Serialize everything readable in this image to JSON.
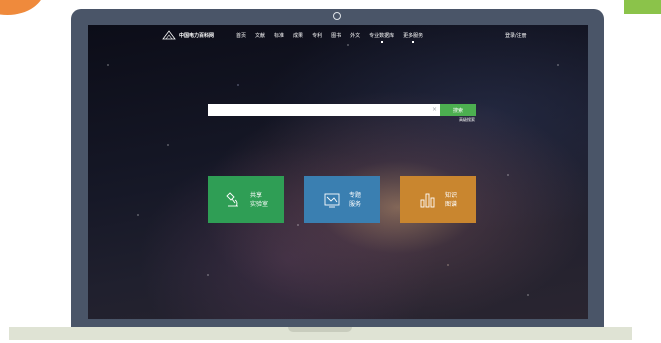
{
  "navbar": {
    "logo_text": "中国电力百科网",
    "items": [
      "首页",
      "文献",
      "标准",
      "成果",
      "专利",
      "图书",
      "外文",
      "专业数据库",
      "更多服务"
    ],
    "login": "登录/注册"
  },
  "search": {
    "placeholder": "",
    "clear_icon": "close-icon",
    "button_label": "搜索",
    "advanced_label": "高级搜索"
  },
  "tiles": [
    {
      "line1": "共享",
      "line2": "实验室",
      "icon": "microscope-icon",
      "color": "#2f9e55"
    },
    {
      "line1": "专题",
      "line2": "服务",
      "icon": "chart-board-icon",
      "color": "#3a7fb1"
    },
    {
      "line1": "知识",
      "line2": "图谱",
      "icon": "bar-chart-icon",
      "color": "#c9862f"
    }
  ],
  "colors": {
    "accent_green": "#4caf50",
    "frame": "#4a5568",
    "deco_orange": "#ef8a3c",
    "deco_green": "#8bc34a"
  }
}
